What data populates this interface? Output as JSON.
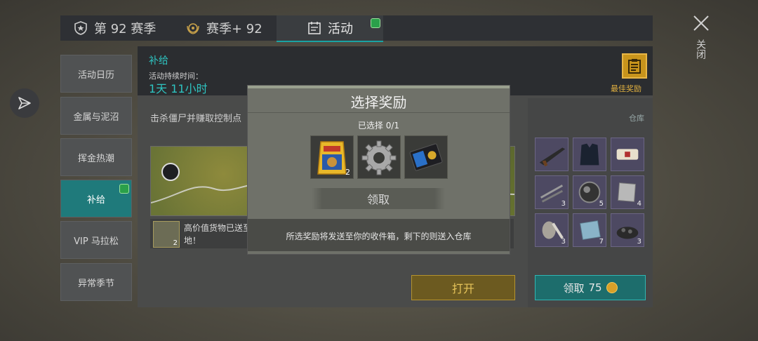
{
  "tabs": [
    {
      "label": "第 92 赛季"
    },
    {
      "label": "赛季+ 92"
    },
    {
      "label": "活动"
    }
  ],
  "close_label": "关闭",
  "sidebar": {
    "items": [
      {
        "label": "活动日历"
      },
      {
        "label": "金属与泥沼"
      },
      {
        "label": "挥金热潮"
      },
      {
        "label": "补给"
      },
      {
        "label": "VIP 马拉松"
      },
      {
        "label": "异常季节"
      }
    ]
  },
  "header": {
    "title": "补给",
    "duration_label": "活动持续时间：",
    "duration_value": "1天 11小时",
    "best_reward_label": "最佳奖励"
  },
  "task_text": "击杀僵尸并赚取控制点",
  "info": {
    "text": "高价值货物已送至 地！",
    "item_count": "2"
  },
  "open_button": "打开",
  "warehouse": {
    "label": "仓库",
    "items": [
      {
        "icon": "rifle-icon",
        "count": ""
      },
      {
        "icon": "armor-vest-icon",
        "count": ""
      },
      {
        "icon": "bandage-icon",
        "count": ""
      },
      {
        "icon": "metal-rods-icon",
        "count": "3"
      },
      {
        "icon": "lens-icon",
        "count": "5"
      },
      {
        "icon": "sheet-metal-icon",
        "count": "4"
      },
      {
        "icon": "mask-bones-icon",
        "count": "3"
      },
      {
        "icon": "glass-pane-icon",
        "count": "7"
      },
      {
        "icon": "gravel-icon",
        "count": "3"
      }
    ],
    "claim_label": "领取",
    "claim_cost": "75"
  },
  "modal": {
    "title": "选择奖励",
    "selected": "已选择 0/1",
    "rewards": [
      {
        "icon": "dog-food-bag-icon",
        "count": "2"
      },
      {
        "icon": "gear-icon",
        "count": ""
      },
      {
        "icon": "badge-wallet-icon",
        "count": ""
      }
    ],
    "claim_label": "领取",
    "note": "所选奖励将发送至你的收件箱，剩下的则送入仓库"
  }
}
